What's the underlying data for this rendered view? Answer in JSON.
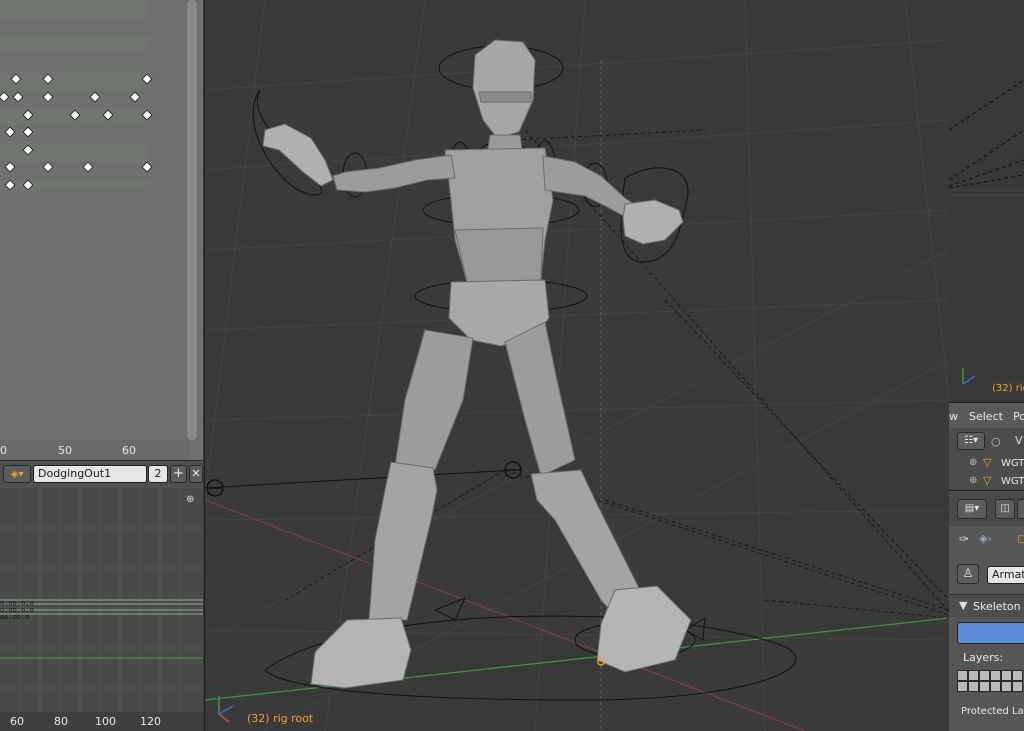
{
  "dopesheet": {
    "ruler_ticks": [
      "0",
      "50",
      "60"
    ]
  },
  "action_bar": {
    "action_name": "DodgingOut1",
    "user_count": "2",
    "add_label": "+",
    "close_label": "✕"
  },
  "nla": {
    "ruler_ticks": [
      "60",
      "80",
      "100",
      "120"
    ]
  },
  "viewport": {
    "status_text": "(32) rig root"
  },
  "right_panel": {
    "view_status": "(32) rig",
    "menu": [
      "w",
      "Select",
      "Po"
    ],
    "outliner": {
      "header_label": "V",
      "items": [
        "WGT",
        "WGT"
      ]
    },
    "properties": {
      "context_field": "Armatu",
      "panel_title": "Skeleton",
      "layers_label": "Layers:",
      "protected_label": "Protected La"
    }
  },
  "colors": {
    "accent_orange": "#f0a030",
    "highlight_blue": "#5a8ad8",
    "ground_green": "#3a9a3a"
  }
}
